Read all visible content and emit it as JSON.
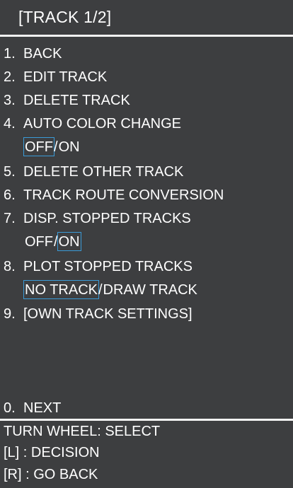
{
  "title": "[TRACK 1/2]",
  "menu": {
    "items": [
      {
        "num": "1.",
        "label": "BACK"
      },
      {
        "num": "2.",
        "label": "EDIT TRACK"
      },
      {
        "num": "3.",
        "label": "DELETE TRACK"
      },
      {
        "num": "4.",
        "label": "AUTO COLOR CHANGE",
        "options": [
          "OFF",
          "ON"
        ],
        "selected": "OFF"
      },
      {
        "num": "5.",
        "label": "DELETE OTHER TRACK"
      },
      {
        "num": "6.",
        "label": "TRACK ROUTE CONVERSION"
      },
      {
        "num": "7.",
        "label": "DISP. STOPPED TRACKS",
        "options": [
          "OFF",
          "ON"
        ],
        "selected": "ON"
      },
      {
        "num": "8.",
        "label": "PLOT STOPPED TRACKS",
        "options": [
          "NO TRACK",
          "DRAW TRACK"
        ],
        "selected": "NO TRACK"
      },
      {
        "num": "9.",
        "label": "[OWN TRACK SETTINGS]"
      },
      {
        "num": "0.",
        "label": "NEXT"
      }
    ],
    "option_separator": "/"
  },
  "guide": {
    "line1": "TURN WHEEL: SELECT",
    "line2": "[L] : DECISION",
    "line3": "[R] : GO BACK"
  },
  "colors": {
    "background": "#3d3e40",
    "text": "#ffffff",
    "selection_outline": "#3a9bd8",
    "divider": "#f2f2f2"
  }
}
